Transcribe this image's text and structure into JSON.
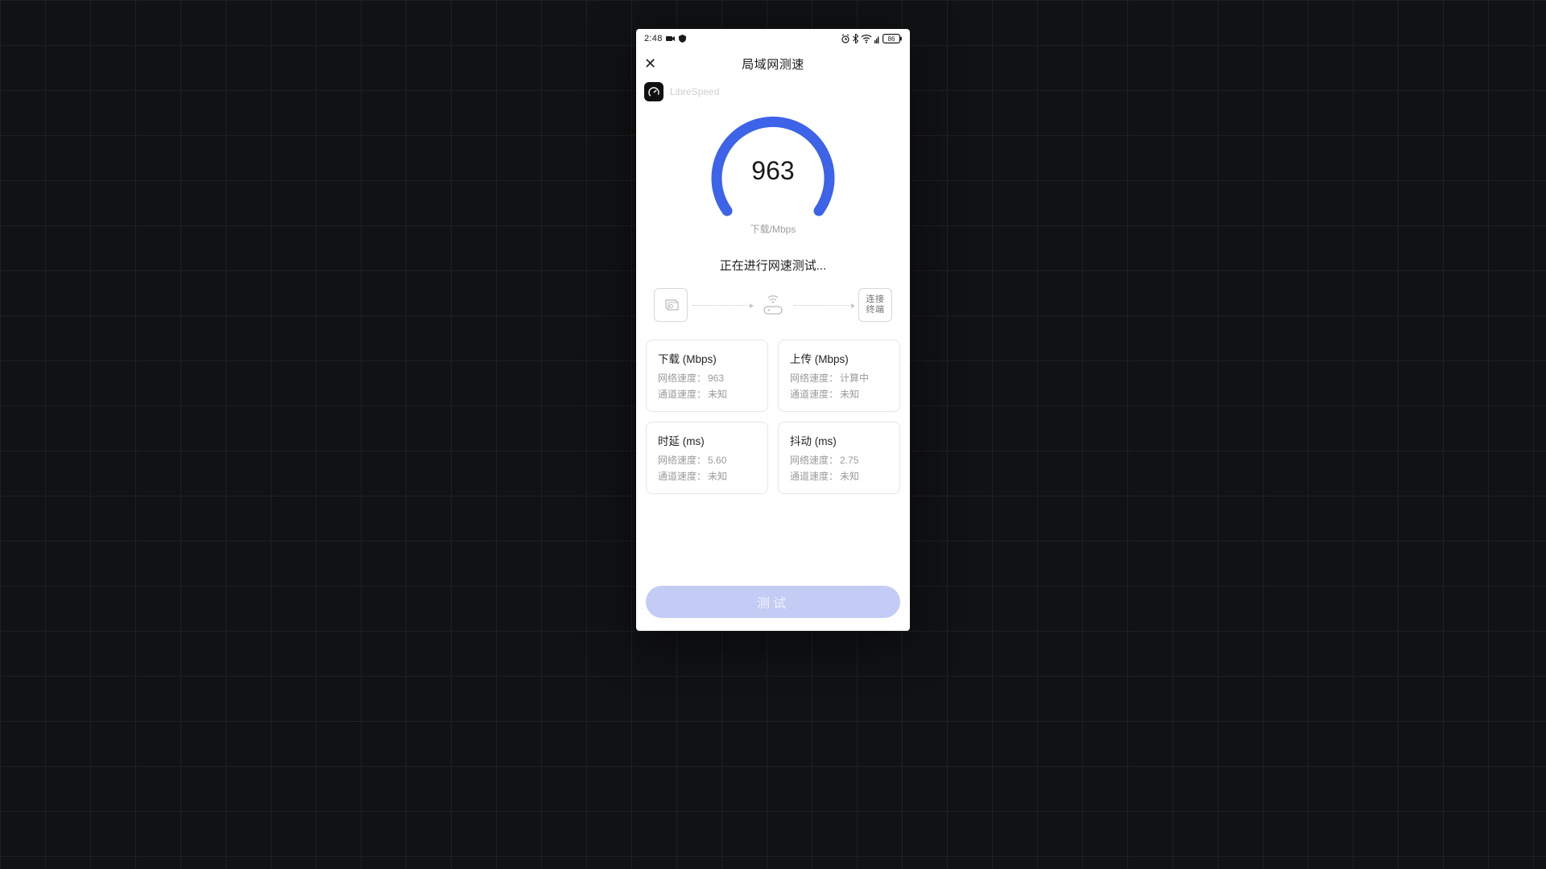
{
  "statusbar": {
    "time": "2:48",
    "battery": "86"
  },
  "header": {
    "title": "局域网测速",
    "close_label": "✕"
  },
  "brand": {
    "name": "LibreSpeed"
  },
  "gauge": {
    "value": "963",
    "unit": "下载/Mbps"
  },
  "progress_text": "正在进行网速测试...",
  "topology": {
    "endpoint_label": "连接\n终端"
  },
  "metrics": {
    "download": {
      "title": "下载 (Mbps)",
      "row1_label": "网络速度：",
      "row1_value": "963",
      "row2_label": "通道速度：",
      "row2_value": "未知"
    },
    "upload": {
      "title": "上传 (Mbps)",
      "row1_label": "网络速度：",
      "row1_value": "计算中",
      "row2_label": "通道速度：",
      "row2_value": "未知"
    },
    "latency": {
      "title": "时延 (ms)",
      "row1_label": "网络速度：",
      "row1_value": "5.60",
      "row2_label": "通道速度：",
      "row2_value": "未知"
    },
    "jitter": {
      "title": "抖动 (ms)",
      "row1_label": "网络速度：",
      "row1_value": "2.75",
      "row2_label": "通道速度：",
      "row2_value": "未知"
    }
  },
  "test_button": "测试",
  "colors": {
    "accent": "#3c63e8",
    "btn": "#c2ccf5"
  }
}
